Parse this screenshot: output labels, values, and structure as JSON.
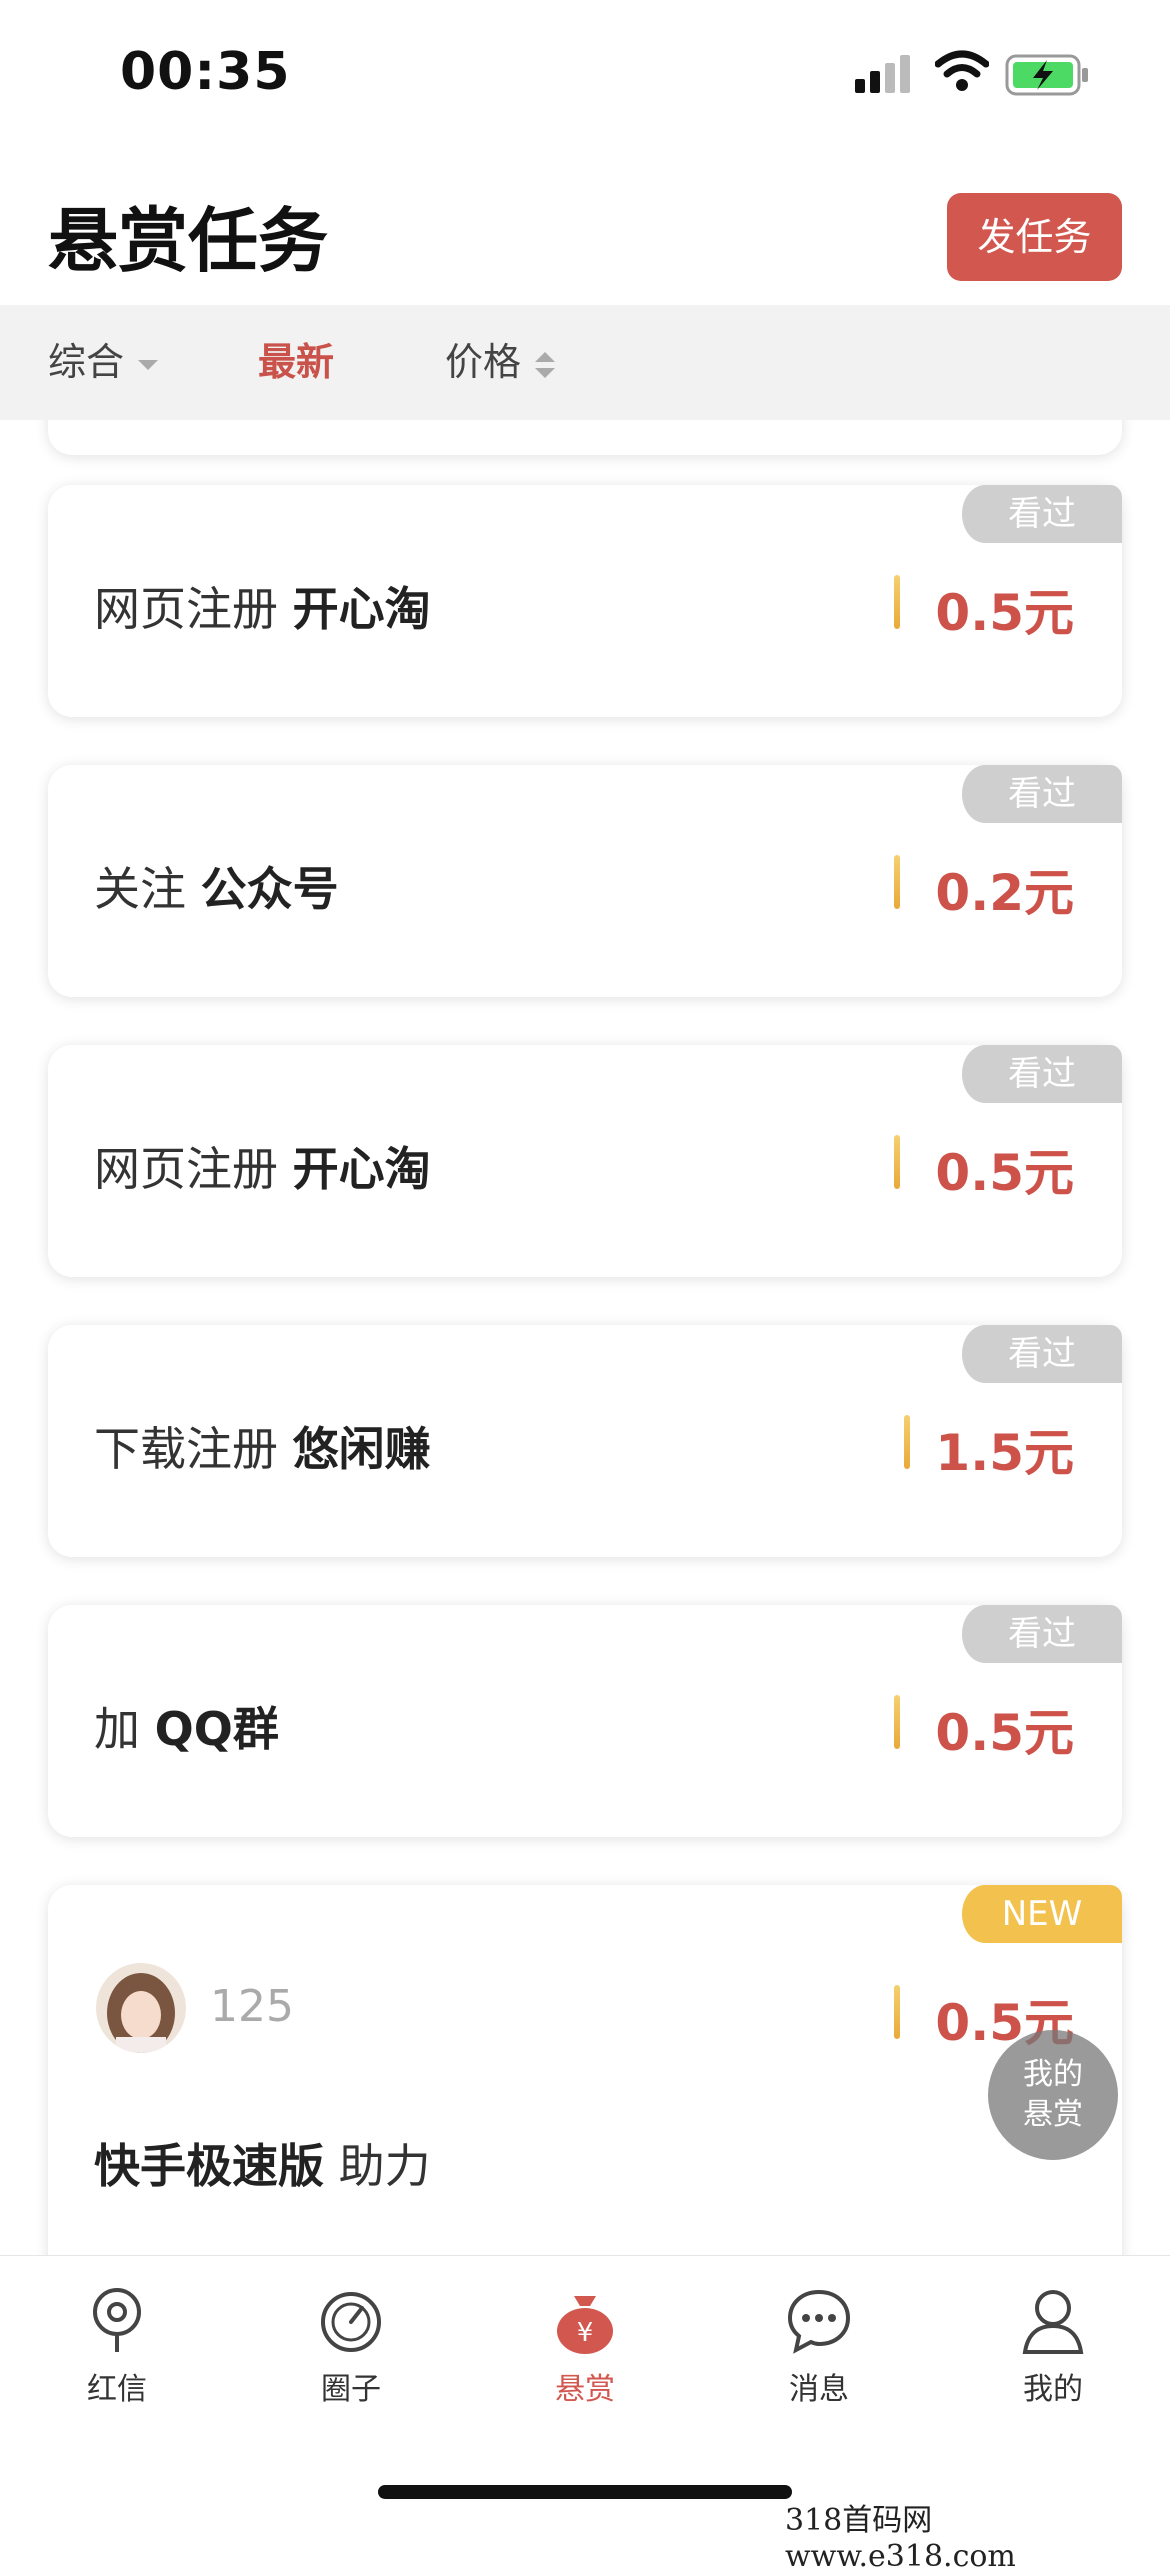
{
  "status_bar": {
    "time": "00:35"
  },
  "header": {
    "title": "悬赏任务",
    "post_button": "发任务"
  },
  "filters": [
    {
      "label": "综合",
      "active": false
    },
    {
      "label": "最新",
      "active": true
    },
    {
      "label": "价格",
      "active": false
    }
  ],
  "tasks": [
    {
      "tag": "看过",
      "action": "网页注册",
      "name": "开心淘",
      "reward": "0.5元"
    },
    {
      "tag": "看过",
      "action": "关注",
      "name": "公众号",
      "reward": "0.2元"
    },
    {
      "tag": "看过",
      "action": "网页注册",
      "name": "开心淘",
      "reward": "0.5元"
    },
    {
      "tag": "看过",
      "action": "下载注册",
      "name": "悠闲赚",
      "reward": "1.5元"
    },
    {
      "tag": "看过",
      "action": "加",
      "name": "QQ群",
      "reward": "0.5元"
    }
  ],
  "new_task": {
    "tag": "NEW",
    "user_number": "125",
    "reward": "0.5元",
    "name": "快手极速版",
    "action": "助力"
  },
  "float_button": {
    "line1": "我的",
    "line2": "悬赏"
  },
  "tabs": [
    {
      "label": "红信",
      "icon": "location-pin-icon"
    },
    {
      "label": "圈子",
      "icon": "gauge-icon"
    },
    {
      "label": "悬赏",
      "icon": "money-bag-icon",
      "active": true
    },
    {
      "label": "消息",
      "icon": "chat-bubble-icon"
    },
    {
      "label": "我的",
      "icon": "user-icon"
    }
  ],
  "watermark": "318首码网 www.e318.com",
  "colors": {
    "accent": "#d2574f",
    "new_tag": "#f2c14e",
    "seen_tag": "#cfcfcf"
  }
}
